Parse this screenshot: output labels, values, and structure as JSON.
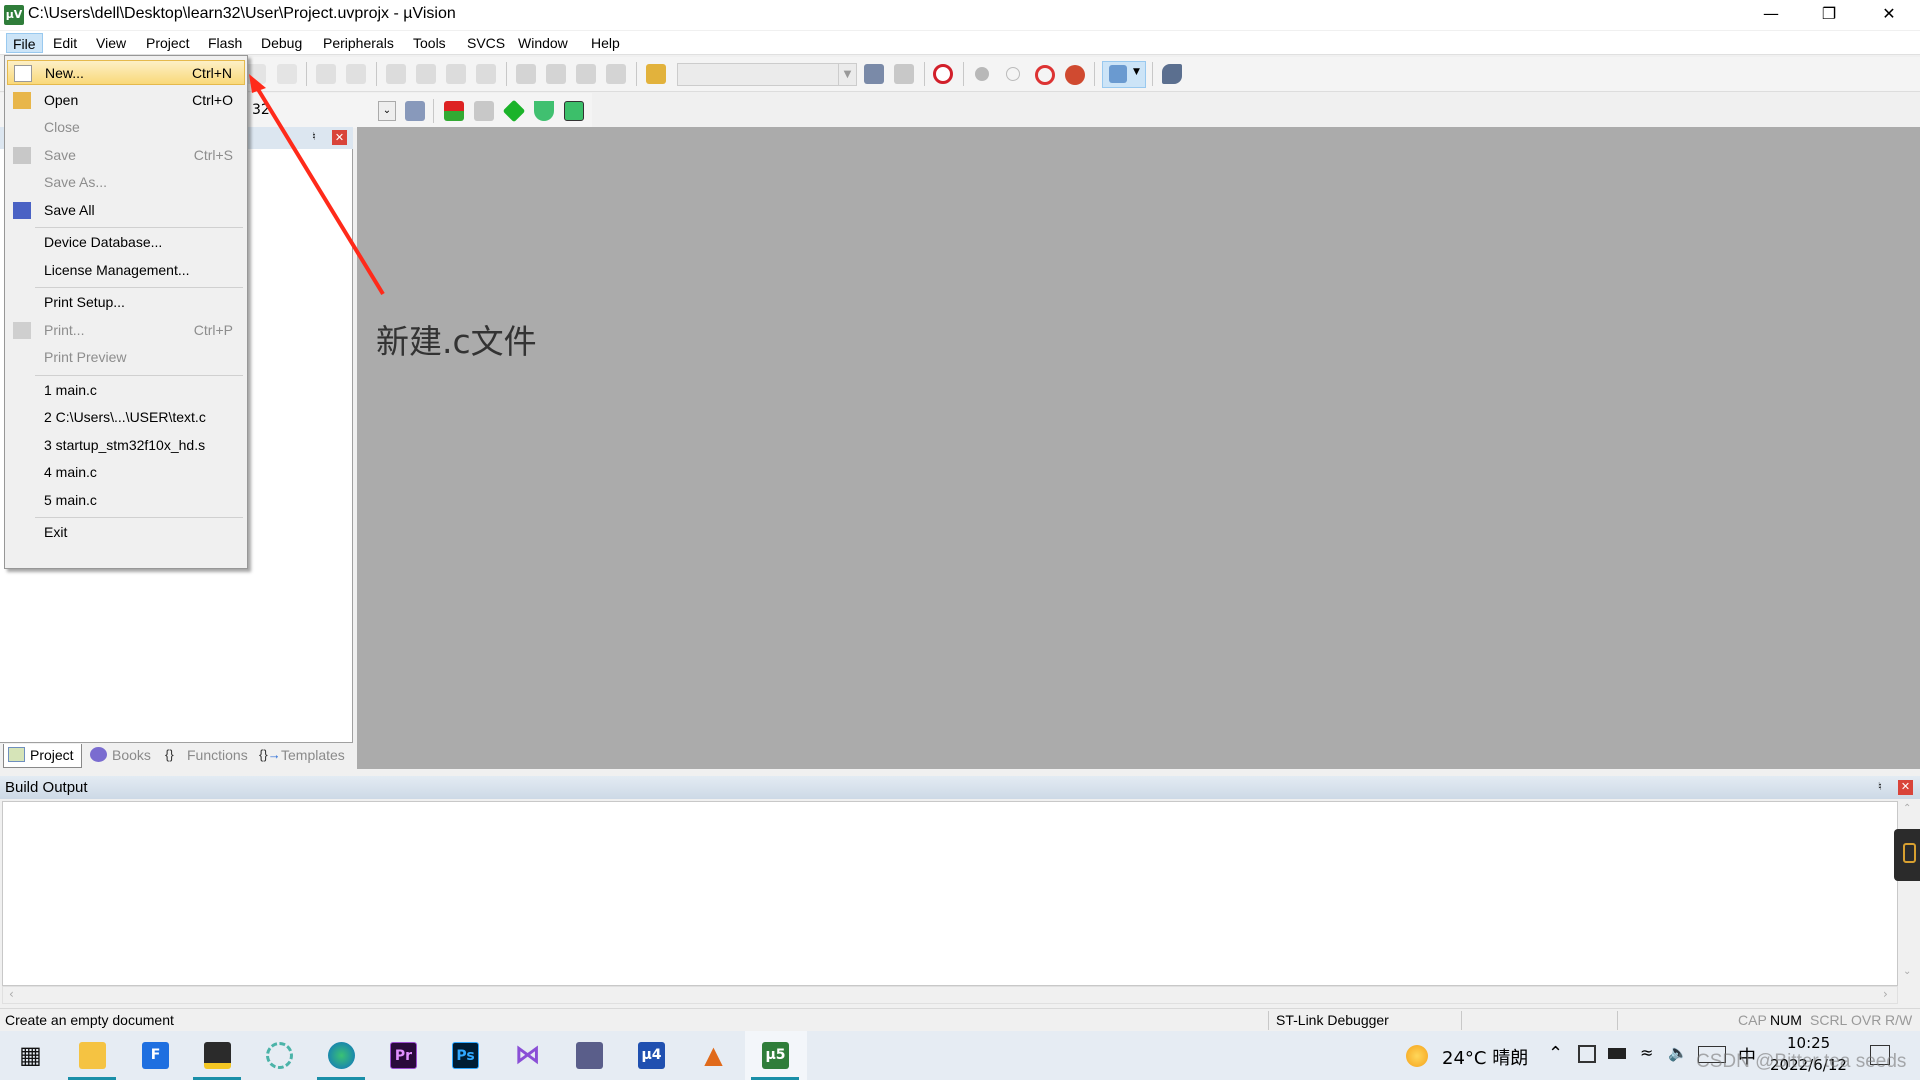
{
  "window": {
    "title": "C:\\Users\\dell\\Desktop\\learn32\\User\\Project.uvprojx - µVision",
    "app_icon": "uvision-icon",
    "controls": [
      "minimize",
      "restore",
      "close"
    ]
  },
  "menubar": [
    "File",
    "Edit",
    "View",
    "Project",
    "Flash",
    "Debug",
    "Peripherals",
    "Tools",
    "SVCS",
    "Window",
    "Help"
  ],
  "toolbar2": {
    "target_partial": "32"
  },
  "file_menu": [
    {
      "label": "New...",
      "shortcut": "Ctrl+N",
      "enabled": true,
      "highlighted": true,
      "icon": "new-file-icon"
    },
    {
      "label": "Open",
      "shortcut": "Ctrl+O",
      "enabled": true,
      "icon": "open-folder-icon"
    },
    {
      "label": "Close",
      "shortcut": "",
      "enabled": false
    },
    {
      "label": "Save",
      "shortcut": "Ctrl+S",
      "enabled": false,
      "icon": "save-icon"
    },
    {
      "label": "Save As...",
      "shortcut": "",
      "enabled": false
    },
    {
      "label": "Save All",
      "shortcut": "",
      "enabled": true,
      "icon": "save-all-icon"
    },
    {
      "separator": true
    },
    {
      "label": "Device Database...",
      "shortcut": "",
      "enabled": true
    },
    {
      "label": "License Management...",
      "shortcut": "",
      "enabled": true
    },
    {
      "separator": true
    },
    {
      "label": "Print Setup...",
      "shortcut": "",
      "enabled": true
    },
    {
      "label": "Print...",
      "shortcut": "Ctrl+P",
      "enabled": false,
      "icon": "printer-icon"
    },
    {
      "label": "Print Preview",
      "shortcut": "",
      "enabled": false
    },
    {
      "separator": true
    },
    {
      "label": "1 main.c",
      "shortcut": "",
      "enabled": true
    },
    {
      "label": "2 C:\\Users\\...\\USER\\text.c",
      "shortcut": "",
      "enabled": true
    },
    {
      "label": "3 startup_stm32f10x_hd.s",
      "shortcut": "",
      "enabled": true
    },
    {
      "label": "4 main.c",
      "shortcut": "",
      "enabled": true
    },
    {
      "label": "5 main.c",
      "shortcut": "",
      "enabled": true
    },
    {
      "separator": true
    },
    {
      "label": "Exit",
      "shortcut": "",
      "enabled": true
    }
  ],
  "panel_tabs": [
    {
      "label": "Project",
      "selected": true
    },
    {
      "label": "Books"
    },
    {
      "label": "Functions"
    },
    {
      "label": "Templates"
    }
  ],
  "build_output": {
    "title": "Build Output",
    "content": ""
  },
  "statusbar": {
    "message": "Create an empty document",
    "debugger": "ST-Link Debugger",
    "indicators": [
      "CAP",
      "NUM",
      "SCRL",
      "OVR",
      "R/W"
    ],
    "active_indicator": "NUM"
  },
  "annotation": {
    "text": "新建.c文件",
    "arrow_color": "#ff2a1a"
  },
  "taskbar": {
    "apps": [
      "windows-start",
      "file-explorer",
      "foxit",
      "sticky-notes",
      "app-spiral",
      "edge",
      "premiere",
      "photoshop",
      "visual-studio",
      "settings-app",
      "keil-uv4",
      "matlab",
      "keil-uv5"
    ],
    "weather": "24°C 晴朗",
    "ime": "中",
    "time": "10:25",
    "date": "2022/6/12"
  },
  "watermark": "CSDN @Bitter tea seeds",
  "colors": {
    "editor_bg": "#ababab",
    "menu_highlight": "#f9d97a",
    "taskbar_underline": "#1a8fa8"
  }
}
